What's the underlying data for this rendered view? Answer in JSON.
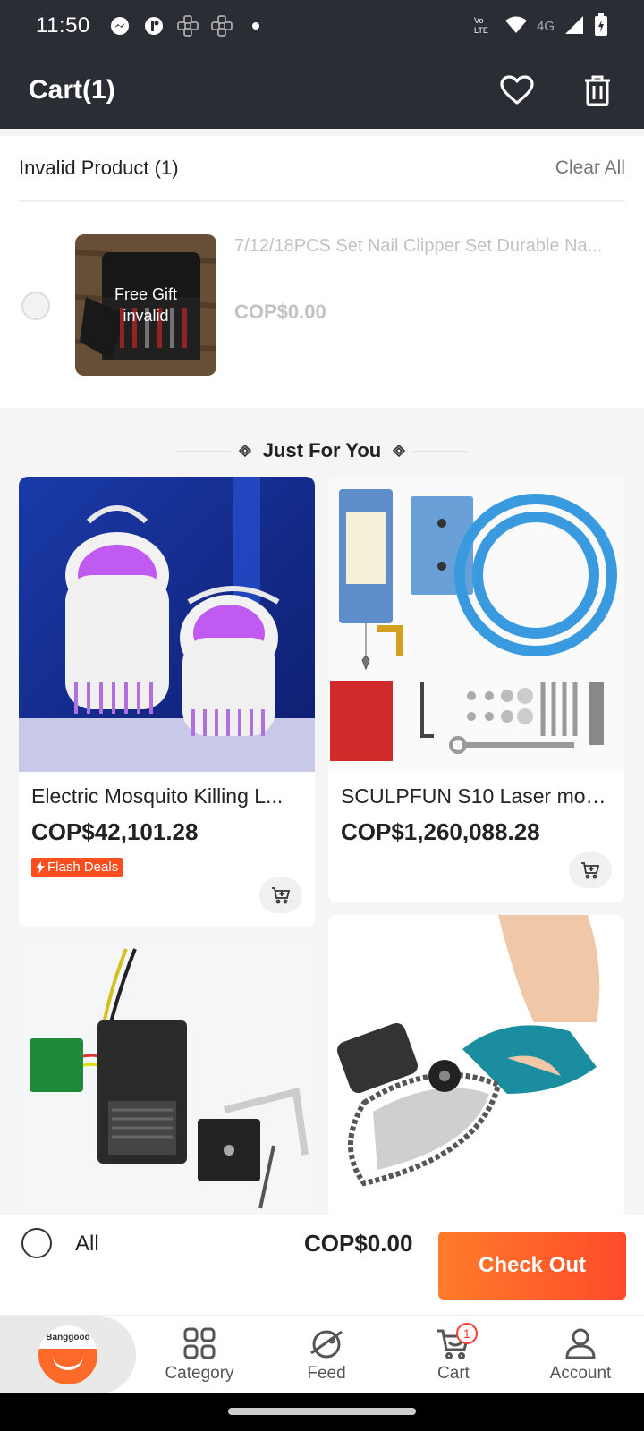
{
  "status": {
    "time": "11:50",
    "network": "4G"
  },
  "header": {
    "title": "Cart(1)"
  },
  "invalid": {
    "title": "Invalid Product (1)",
    "clear_label": "Clear All",
    "item": {
      "name": "7/12/18PCS Set Nail Clipper Set Durable Na...",
      "price": "COP$0.00",
      "overlay_line1": "Free Gift",
      "overlay_line2": "invalid"
    }
  },
  "recommend": {
    "title": "Just For You"
  },
  "products": [
    {
      "name": "Electric Mosquito Killing L...",
      "price": "COP$42,101.28",
      "badge": "Flash Deals"
    },
    {
      "name": "SCULPFUN S10 Laser mod...",
      "price": "COP$1,260,088.28"
    }
  ],
  "bottom": {
    "all_label": "All",
    "total": "COP$0.00",
    "checkout_label": "Check Out"
  },
  "nav": {
    "logo_text": "Banggood",
    "items": [
      {
        "label": "Category",
        "icon": "category-icon"
      },
      {
        "label": "Feed",
        "icon": "feed-icon"
      },
      {
        "label": "Cart",
        "icon": "cart-icon",
        "badge": "1"
      },
      {
        "label": "Account",
        "icon": "account-icon"
      }
    ]
  },
  "colors": {
    "header_bg": "#2b2d35",
    "accent": "#ff5a2a",
    "flash": "#ff4e1e"
  }
}
